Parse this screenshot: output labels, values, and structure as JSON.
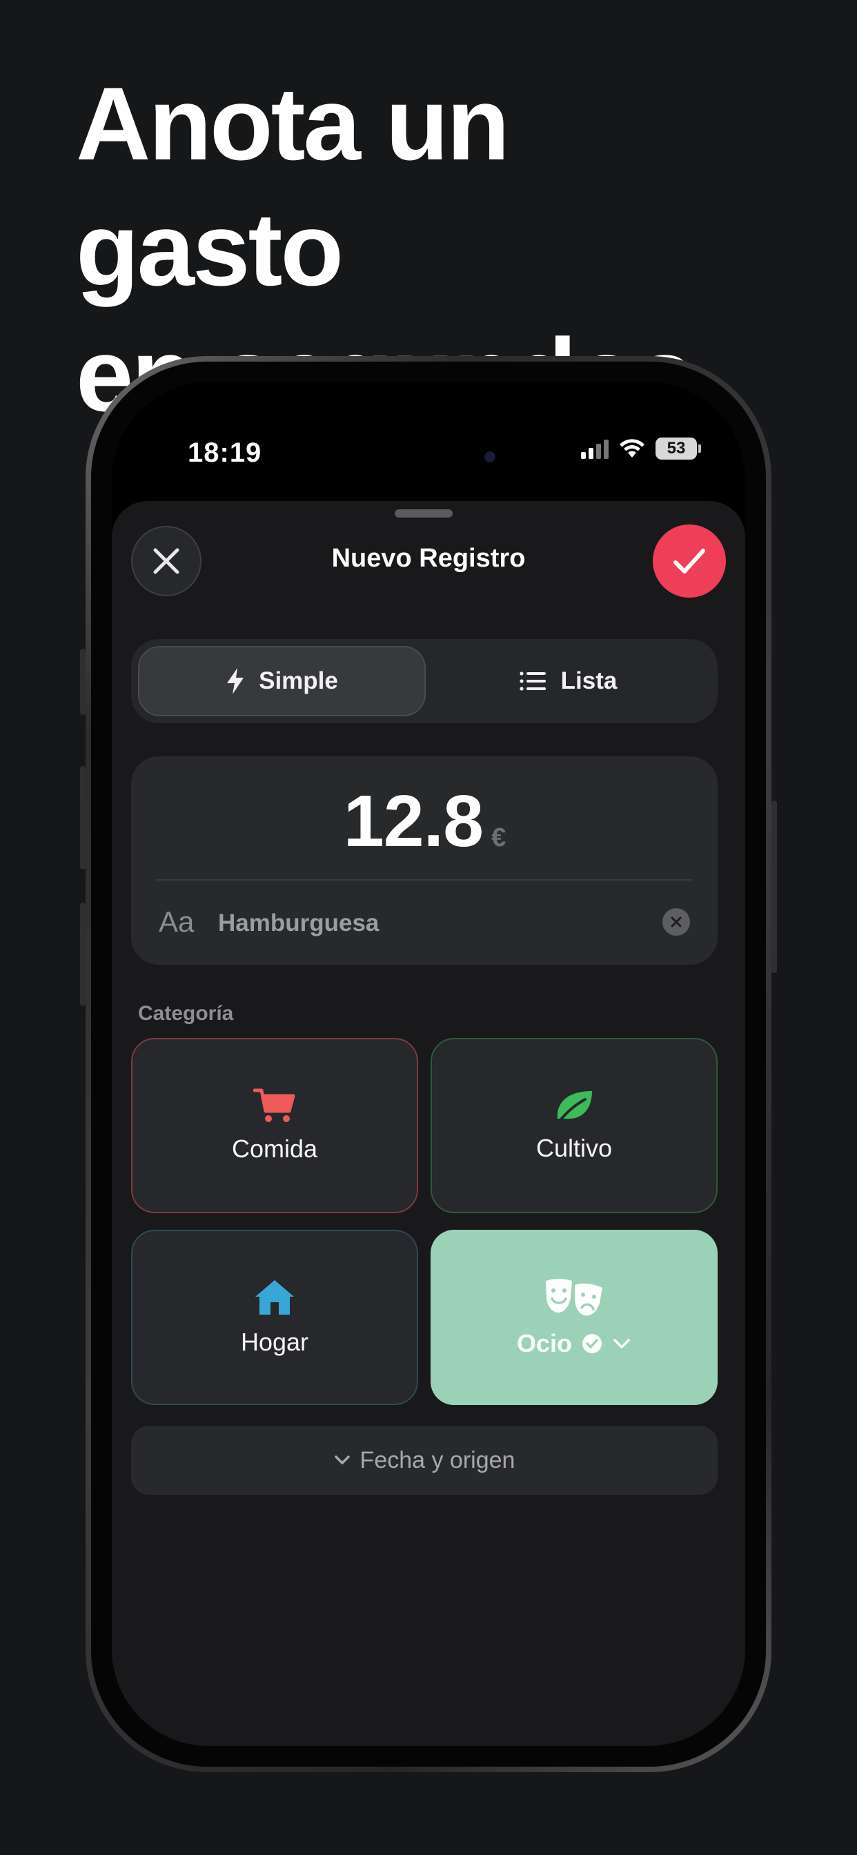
{
  "headline": {
    "line1": "Anota un gasto",
    "line2": "en segundos"
  },
  "status_bar": {
    "time": "18:19",
    "battery": "53"
  },
  "header": {
    "title": "Nuevo Registro"
  },
  "mode_tabs": [
    {
      "label": "Simple",
      "icon": "bolt-icon",
      "active": true
    },
    {
      "label": "Lista",
      "icon": "list-icon",
      "active": false
    }
  ],
  "entry": {
    "amount": "12.8",
    "currency": "€",
    "text_prefix": "Aa",
    "description": "Hamburguesa"
  },
  "category_section": {
    "label": "Categoría"
  },
  "categories": [
    {
      "label": "Comida",
      "icon": "shopping-cart-icon",
      "color": "#ef5a5a"
    },
    {
      "label": "Cultivo",
      "icon": "leaf-icon",
      "color": "#3dbb5a"
    },
    {
      "label": "Hogar",
      "icon": "house-icon",
      "color": "#3aa6d8"
    },
    {
      "label": "Ocio",
      "icon": "theater-masks-icon",
      "color": "#9bd2b7",
      "selected": true
    }
  ],
  "details_toggle": {
    "label": "Fecha y origen"
  },
  "colors": {
    "background": "#161719",
    "sheet": "#19191b",
    "accent_confirm": "#ef3e57",
    "selected_category": "#9bd2b7"
  }
}
